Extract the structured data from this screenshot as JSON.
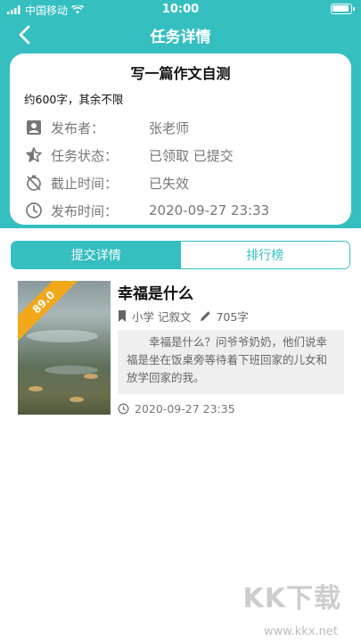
{
  "statusbar": {
    "carrier": "中国移动",
    "time": "10:00",
    "battery_level": 1.0
  },
  "nav": {
    "title": "任务详情"
  },
  "task": {
    "title": "写一篇作文自测",
    "description": "约600字，其余不限",
    "publisher_label": "发布者：",
    "publisher_value": "张老师",
    "status_label": "任务状态：",
    "status_value": "已领取 已提交",
    "deadline_label": "截止时间：",
    "deadline_value": "已失效",
    "publish_time_label": "发布时间：",
    "publish_time_value": "2020-09-27 23:33"
  },
  "tabs": [
    {
      "label": "提交详情",
      "active": true
    },
    {
      "label": "排行榜",
      "active": false
    }
  ],
  "submission": {
    "score": "89.0",
    "title": "幸福是什么",
    "tags": "小学 记叙文",
    "word_count": "705字",
    "excerpt": "幸福是什么？问爷爷奶奶，他们说幸福是坐在饭桌旁等待着下班回家的儿女和放学回家的我。",
    "date": "2020-09-27 23:35"
  },
  "watermark": {
    "text": "KK下载",
    "url": "www.kkx.net"
  },
  "colors": {
    "accent": "#35bfc1",
    "ribbon": "#f3a81c"
  }
}
